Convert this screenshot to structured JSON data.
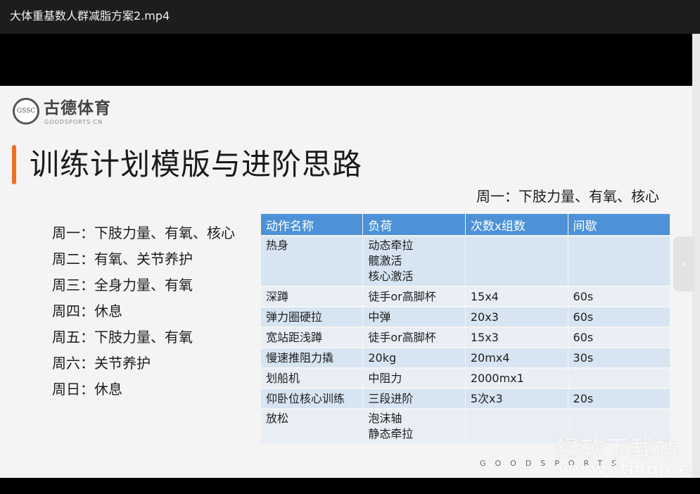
{
  "window": {
    "title": "大体重基数人群减脂方案2.mp4"
  },
  "logo": {
    "seal_text": "GSSC",
    "name": "古德体育",
    "sub": "GOODSPORTS·CN"
  },
  "slide": {
    "title": "训练计划模版与进阶思路",
    "caption": "周一：下肢力量、有氧、核心",
    "schedule": [
      "周一：下肢力量、有氧、核心",
      "周二：有氧、关节养护",
      "周三：全身力量、有氧",
      "周四：休息",
      "周五：下肢力量、有氧",
      "周六：关节养护",
      "周日：休息"
    ],
    "table": {
      "headers": [
        "动作名称",
        "负荷",
        "次数x组数",
        "间歇"
      ],
      "rows": [
        {
          "name": "热身",
          "load": [
            "动态牵拉",
            "髋激活",
            "核心激活"
          ],
          "reps": "",
          "rest": ""
        },
        {
          "name": "深蹲",
          "load": [
            "徒手or高脚杯"
          ],
          "reps": "15x4",
          "rest": "60s"
        },
        {
          "name": "弹力圈硬拉",
          "load": [
            "中弹"
          ],
          "reps": "20x3",
          "rest": "60s"
        },
        {
          "name": "宽站距浅蹲",
          "load": [
            "徒手or高脚杯"
          ],
          "reps": "15x3",
          "rest": "60s"
        },
        {
          "name": "慢速推阻力撬",
          "load": [
            "20kg"
          ],
          "reps": "20mx4",
          "rest": "30s"
        },
        {
          "name": "划船机",
          "load": [
            "中阻力"
          ],
          "reps": "2000mx1",
          "rest": ""
        },
        {
          "name": "仰卧位核心训练",
          "load": [
            "三段进阶"
          ],
          "reps": "5次x3",
          "rest": "20s"
        },
        {
          "name": "放松",
          "load": [
            "泡沫轴",
            "静态牵拉"
          ],
          "reps": "",
          "rest": ""
        }
      ]
    },
    "footer": "GOODSPORTS"
  },
  "watermark": {
    "cn": "绿软下载站",
    "url": "www.itmop.com"
  },
  "player": {
    "next_icon": "chevron-right-icon"
  },
  "colors": {
    "accent": "#ef7020",
    "header": "#4d92d6",
    "row_a": "#d7e5f2",
    "row_b": "#e9eef5"
  }
}
